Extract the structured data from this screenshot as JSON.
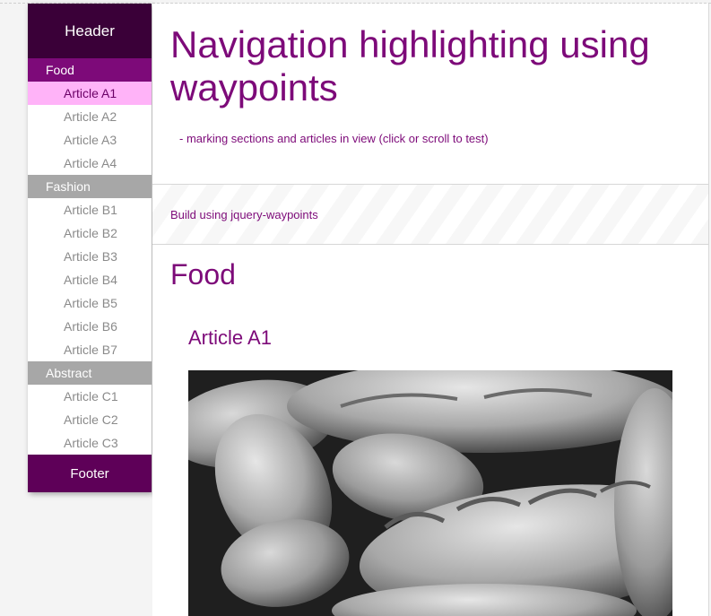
{
  "sidebar": {
    "header": "Header",
    "sections": [
      {
        "label": "Food",
        "active": true,
        "items": [
          {
            "label": "Article A1",
            "active": true
          },
          {
            "label": "Article A2",
            "active": false
          },
          {
            "label": "Article A3",
            "active": false
          },
          {
            "label": "Article A4",
            "active": false
          }
        ]
      },
      {
        "label": "Fashion",
        "active": false,
        "items": [
          {
            "label": "Article B1",
            "active": false
          },
          {
            "label": "Article B2",
            "active": false
          },
          {
            "label": "Article B3",
            "active": false
          },
          {
            "label": "Article B4",
            "active": false
          },
          {
            "label": "Article B5",
            "active": false
          },
          {
            "label": "Article B6",
            "active": false
          },
          {
            "label": "Article B7",
            "active": false
          }
        ]
      },
      {
        "label": "Abstract",
        "active": false,
        "items": [
          {
            "label": "Article C1",
            "active": false
          },
          {
            "label": "Article C2",
            "active": false
          },
          {
            "label": "Article C3",
            "active": false
          }
        ]
      }
    ],
    "footer": "Footer"
  },
  "main": {
    "title": "Navigation highlighting using waypoints",
    "subtitle": "- marking sections and articles in view (click or scroll to test)",
    "build_link": "Build using jquery-waypoints",
    "section_title": "Food",
    "article_title": "Article A1",
    "image_icon": "bread-photo"
  },
  "colors": {
    "accent": "#7d0a79",
    "header_bg": "#3a0038",
    "footer_bg": "#5e0058",
    "active_item_bg": "#ffb3f8",
    "inactive_section_bg": "#a7a7a7"
  }
}
